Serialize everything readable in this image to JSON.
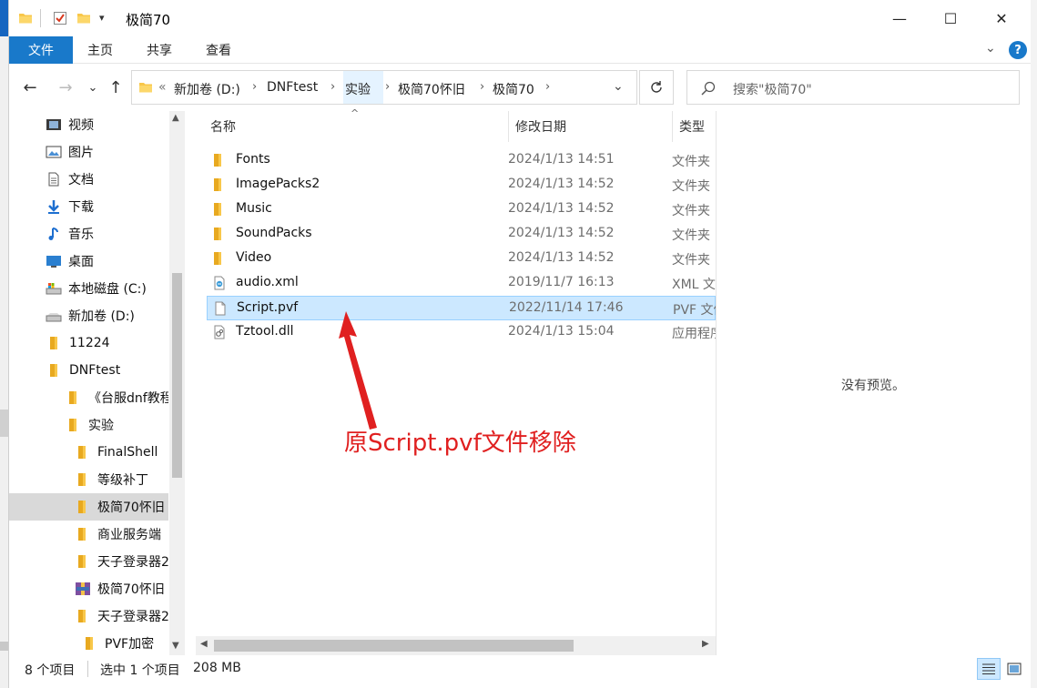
{
  "window": {
    "title": "极简70",
    "controls": {
      "minimize": "—",
      "maximize": "☐",
      "close": "✕"
    }
  },
  "ribbon": {
    "tabs": [
      {
        "label": "文件",
        "active": true
      },
      {
        "label": "主页"
      },
      {
        "label": "共享"
      },
      {
        "label": "查看"
      }
    ],
    "help": "?"
  },
  "nav_buttons": {
    "back": "←",
    "forward": "→",
    "recent": "⌄",
    "up": "↑"
  },
  "address": {
    "overflow": "«",
    "crumbs": [
      "新加卷 (D:)",
      "DNFtest",
      "实验",
      "极简70怀旧",
      "极简70"
    ],
    "separator": "›"
  },
  "search": {
    "placeholder": "搜索\"极简70\""
  },
  "navpane": {
    "items": [
      {
        "label": "视频",
        "icon": "video-icon",
        "indent": 0
      },
      {
        "label": "图片",
        "icon": "pictures-icon",
        "indent": 0
      },
      {
        "label": "文档",
        "icon": "documents-icon",
        "indent": 0
      },
      {
        "label": "下载",
        "icon": "download-icon",
        "indent": 0
      },
      {
        "label": "音乐",
        "icon": "music-icon",
        "indent": 0
      },
      {
        "label": "桌面",
        "icon": "desktop-icon",
        "indent": 0
      },
      {
        "label": "本地磁盘 (C:)",
        "icon": "drive-c-icon",
        "indent": 0
      },
      {
        "label": "新加卷 (D:)",
        "icon": "drive-d-icon",
        "indent": 0
      },
      {
        "label": "11224",
        "icon": "folder-icon",
        "indent": 1
      },
      {
        "label": "DNFtest",
        "icon": "folder-icon",
        "indent": 1
      },
      {
        "label": "《台服dnf教程",
        "icon": "folder-icon",
        "indent": 2
      },
      {
        "label": "实验",
        "icon": "folder-icon",
        "indent": 2
      },
      {
        "label": "FinalShell",
        "icon": "folder-icon",
        "indent": 3
      },
      {
        "label": "等级补丁",
        "icon": "folder-icon",
        "indent": 3
      },
      {
        "label": "极简70怀旧",
        "icon": "folder-icon",
        "indent": 3,
        "selected": true
      },
      {
        "label": "商业服务端",
        "icon": "folder-icon",
        "indent": 3
      },
      {
        "label": "天子登录器2",
        "icon": "folder-icon",
        "indent": 3
      },
      {
        "label": "极简70怀旧",
        "icon": "archive-icon",
        "indent": 3
      },
      {
        "label": "天子登录器2",
        "icon": "folder-icon",
        "indent": 3
      },
      {
        "label": "PVF加密",
        "icon": "folder-icon",
        "indent": 4
      }
    ]
  },
  "filelist": {
    "columns": {
      "name": "名称",
      "date": "修改日期",
      "type": "类型"
    },
    "rows": [
      {
        "name": "Fonts",
        "date": "2024/1/13 14:51",
        "type": "文件夹",
        "icon": "folder-icon"
      },
      {
        "name": "ImagePacks2",
        "date": "2024/1/13 14:52",
        "type": "文件夹",
        "icon": "folder-icon"
      },
      {
        "name": "Music",
        "date": "2024/1/13 14:52",
        "type": "文件夹",
        "icon": "folder-icon"
      },
      {
        "name": "SoundPacks",
        "date": "2024/1/13 14:52",
        "type": "文件夹",
        "icon": "folder-icon"
      },
      {
        "name": "Video",
        "date": "2024/1/13 14:52",
        "type": "文件夹",
        "icon": "folder-icon"
      },
      {
        "name": "audio.xml",
        "date": "2019/11/7 16:13",
        "type": "XML 文档",
        "icon": "xml-file-icon"
      },
      {
        "name": "Script.pvf",
        "date": "2022/11/14 17:46",
        "type": "PVF 文件",
        "icon": "blank-file-icon",
        "selected": true
      },
      {
        "name": "Tztool.dll",
        "date": "2024/1/13 15:04",
        "type": "应用程序扩展",
        "icon": "dll-file-icon"
      }
    ]
  },
  "preview": {
    "message": "没有预览。"
  },
  "status": {
    "count": "8 个项目",
    "selection": "选中 1 个项目",
    "size": "208 MB"
  },
  "annotation": {
    "text": "原Script.pvf文件移除",
    "color": "#e02020"
  },
  "colors": {
    "accent": "#1979ca",
    "selection": "#cce8ff",
    "folder": "#f8c74a"
  }
}
